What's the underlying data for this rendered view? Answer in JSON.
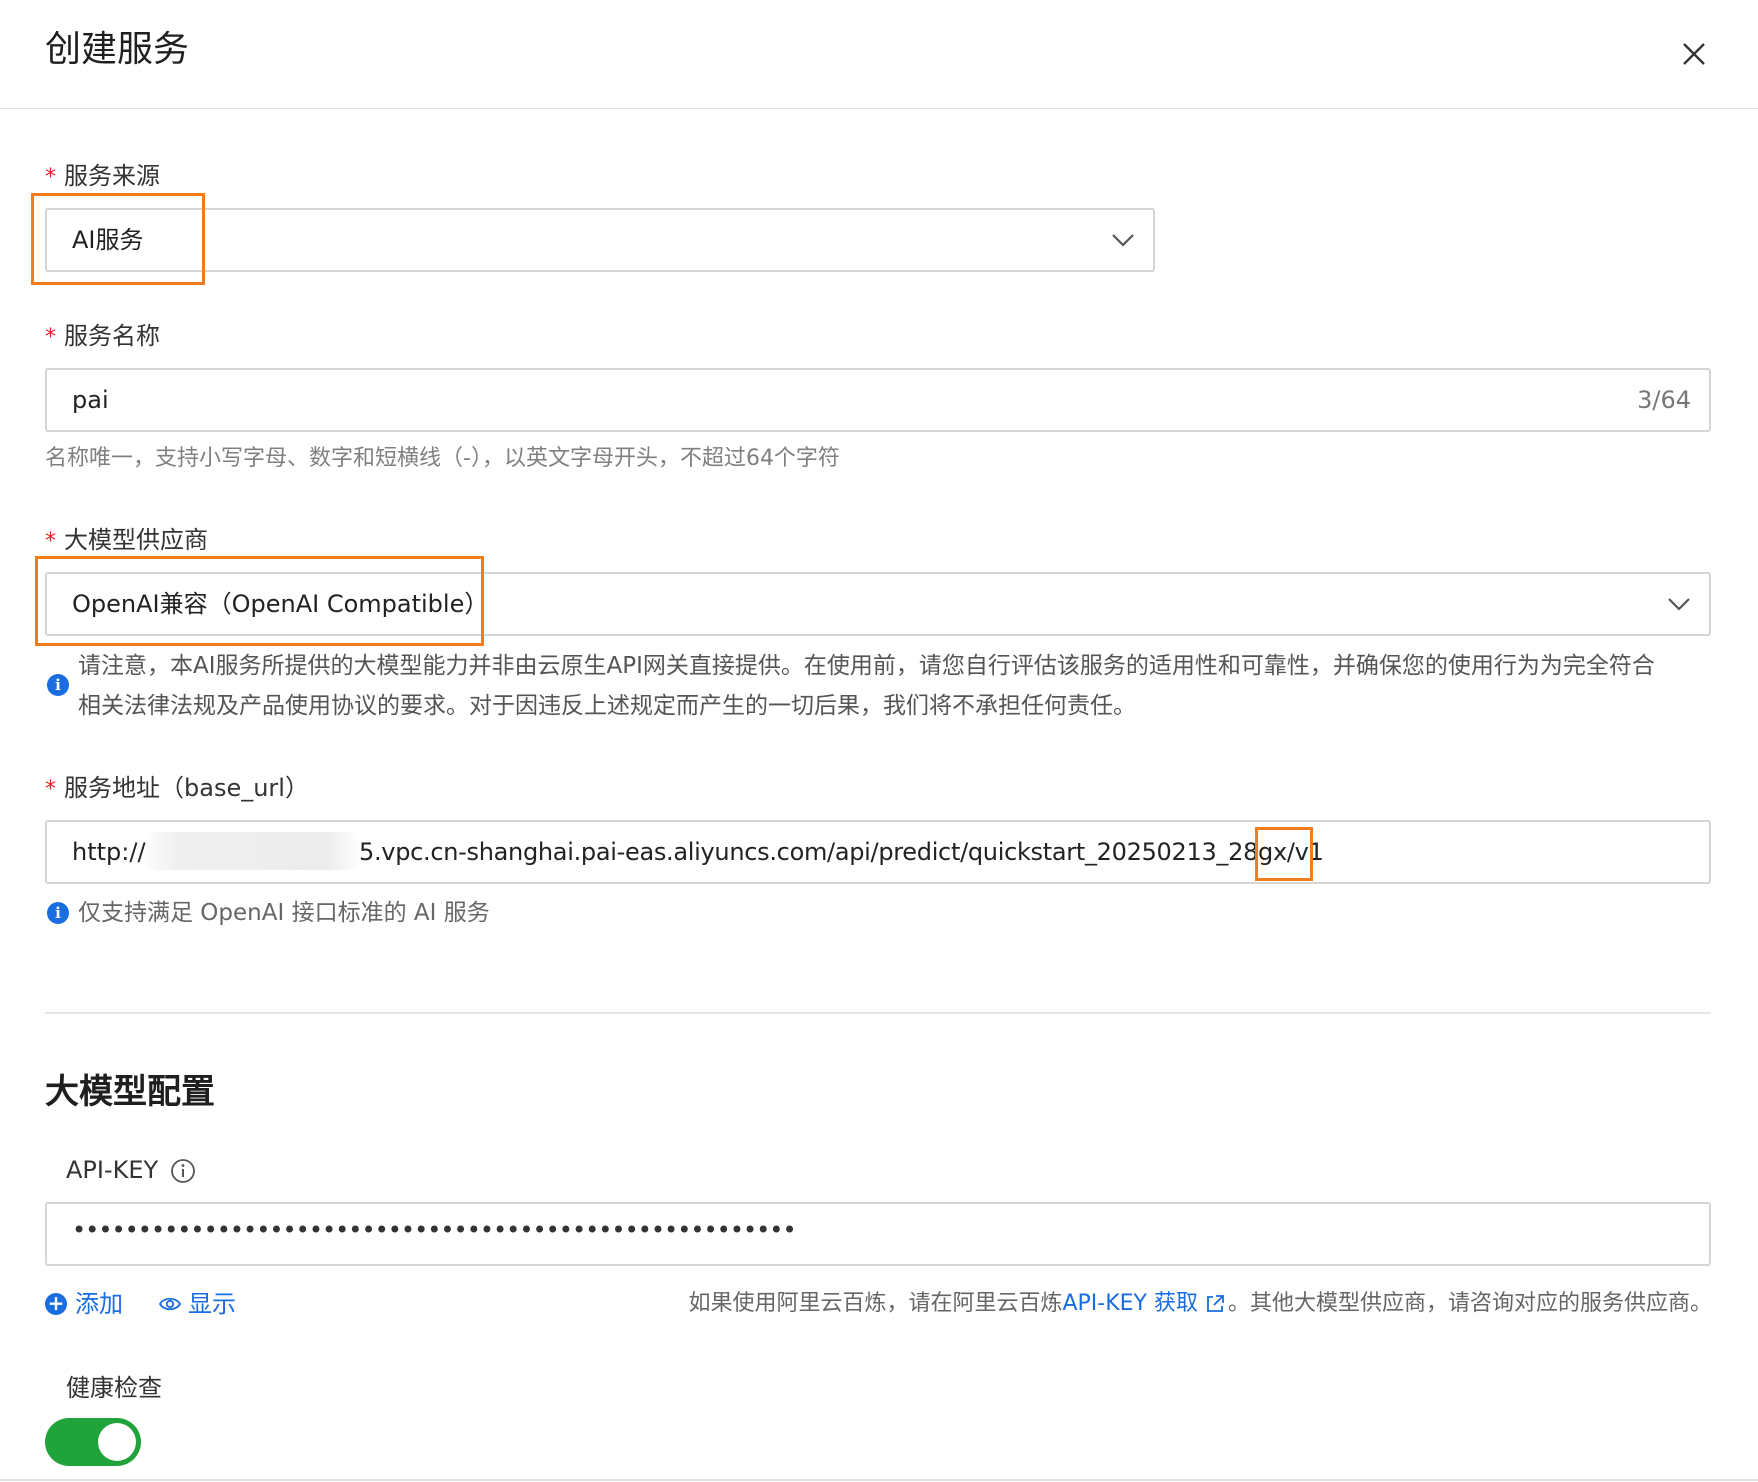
{
  "dialog": {
    "title": "创建服务"
  },
  "service_source": {
    "required_mark": "*",
    "label": "服务来源",
    "value": "AI服务"
  },
  "service_name": {
    "required_mark": "*",
    "label": "服务名称",
    "value": "pai",
    "counter": "3/64",
    "help": "名称唯一，支持小写字母、数字和短横线（-），以英文字母开头，不超过64个字符"
  },
  "model_provider": {
    "required_mark": "*",
    "label": "大模型供应商",
    "value": "OpenAI兼容（OpenAI Compatible）",
    "notice_line1": "请注意，本AI服务所提供的大模型能力并非由云原生API网关直接提供。在使用前，请您自行评估该服务的适用性和可靠性，并确保您的使用行为为完全符合",
    "notice_line2": "相关法律法规及产品使用协议的要求。对于因违反上述规定而产生的一切后果，我们将不承担任何责任。"
  },
  "base_url": {
    "required_mark": "*",
    "label": "服务地址（base_url）",
    "value_prefix": "http://",
    "value_suffix": "5.vpc.cn-shanghai.pai-eas.aliyuncs.com/api/predict/quickstart_20250213_28gx/v1",
    "hint": "仅支持满足 OpenAI 接口标准的 AI 服务"
  },
  "model_config": {
    "section_title": "大模型配置",
    "api_key_label": "API-KEY",
    "api_key_mask": "•••••••••••••••••••••••••••••••••••••••••••••••••••••••",
    "add_label": "添加",
    "show_label": "显示",
    "note_prefix": "如果使用阿里云百炼，请在阿里云百炼",
    "note_link": "API-KEY 获取",
    "note_suffix": "。其他大模型供应商，请咨询对应的服务供应商。"
  },
  "health_check": {
    "label": "健康检查",
    "enabled": true
  },
  "colors": {
    "accent": "#1a6de0",
    "highlight": "#f07c1b",
    "required": "#e5202d",
    "toggle_on": "#1fa33a"
  },
  "icons": [
    "close-icon",
    "chevron-down-icon",
    "info-icon",
    "add-icon",
    "eye-icon",
    "external-link-icon",
    "info-outline-icon"
  ]
}
